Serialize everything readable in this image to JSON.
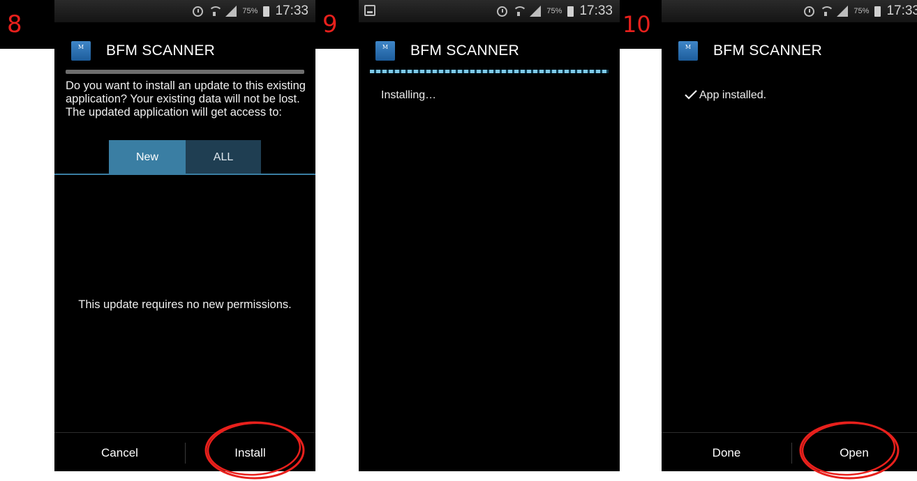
{
  "steps": [
    {
      "number": "8",
      "status": {
        "battery": "75%",
        "time": "17:33"
      },
      "app_title": "BFM SCANNER",
      "message": "Do you want to install an update to this existing application? Your existing data will not be lost. The updated application will get access to:",
      "tabs": [
        "New",
        "ALL"
      ],
      "permissions_text": "This update requires no new permissions.",
      "buttons": {
        "left": "Cancel",
        "right": "Install"
      }
    },
    {
      "number": "9",
      "status": {
        "battery": "75%",
        "time": "17:33"
      },
      "app_title": "BFM SCANNER",
      "message": "Installing…"
    },
    {
      "number": "10",
      "status": {
        "battery": "75%",
        "time": "17:33"
      },
      "app_title": "BFM SCANNER",
      "message": "App installed.",
      "buttons": {
        "left": "Done",
        "right": "Open"
      }
    }
  ],
  "icons": {
    "app": "bfm-app-icon",
    "status": [
      "alarm-icon",
      "wifi-icon",
      "signal-icon",
      "battery-icon"
    ],
    "check": "checkmark-icon",
    "screenshot": "screenshot-notification-icon"
  },
  "colors": {
    "annotation": "#e8201c",
    "tab_active": "#3a7ea3",
    "tab_inactive": "#1f3e52",
    "progress": "#7ec9e8"
  }
}
